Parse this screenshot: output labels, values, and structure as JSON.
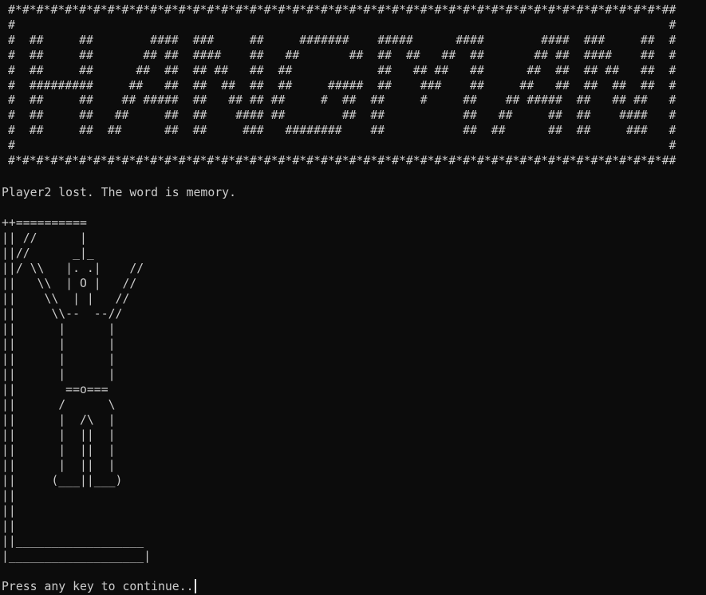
{
  "banner": {
    "lines": [
      "#*#*#*#*#*#*#*#*#*#*#*#*#*#*#*#*#*#*#*#*#*#*#*#*#*#*#*#*#*#*#*#*#*#*#*#*#*#*#*#*#*#*#*#*#*#*#*#*#*#*#*#*#*#*#*#*#*#*#*#*#*#*#*#*#*#*#*#*#*#*#*#*#*#*#*#*#*#*#*#*#*#*#*#*#*#*#*#*#*#*#*#*#*#*#*#*#*#*#*#*#*#*#*#*#*#*#*#*#*#*#*#*#*#*#*#*#",
      "#                                                                                                                                                                          #",
      "#  ##     ##        ####  ###     ##     #######    #####      ####        ####  ###     ##   #",
      "#  ##     ##       ## ##  ####    ##   ##       ##  ##  ##   ##  ##       ## ##  ####    ##   #",
      "#  ##     ##      ##  ##  ## ##   ##  ##            ##   ## ##   ##      ##  ##  ## ##   ##   #",
      "#  #########     ##   ##  ##  ##  ##  ##     #####  ##    ###    ##     ##   ##  ##  ##  ##   #",
      "#  ##     ##    ## #####  ##   ## ## ##     #  ##  ##     #     ##    ## #####  ##   ## ##   #",
      "#  ##     ##   ##     ##  ##    #### ##        ##  ##           ##   ##     ##  ##    ####   #",
      "#  ##     ##  ##      ##  ##     ###   ########    ##           ##  ##      ##  ##     ###   #",
      "#                                                                                           #",
      "#*#*#*#*#*#*#*#*#*#*#*#*#*#*#*#*#*#*#*#*#*#*#*#*#*#*#*#*#*#*#*#*#*#*#*#*#*#*#*#*#*#*#*#*#*#*#"
    ]
  },
  "status_message": "Player2 lost. The word is memory.",
  "hangman_art": "++==========\n|| //      |\n||//      _|_\n||/ \\\\   |. .|    //\n||   \\\\  | O |   //\n||    \\\\  | |   //\n||     \\\\--  --//\n||      |      |\n||      |      |\n||      |      |\n||      |      |\n||       ==o===\n||      /      \\\n||      |  /\\  |\n||      |  ||  |\n||      |  ||  |\n||      |  ||  |\n||     (___||___)\n||\n||\n||\n||__________________\n|___________________|",
  "prompt": "Press any key to continue..",
  "colors": {
    "background": "#0c0c0c",
    "foreground": "#cccccc"
  }
}
